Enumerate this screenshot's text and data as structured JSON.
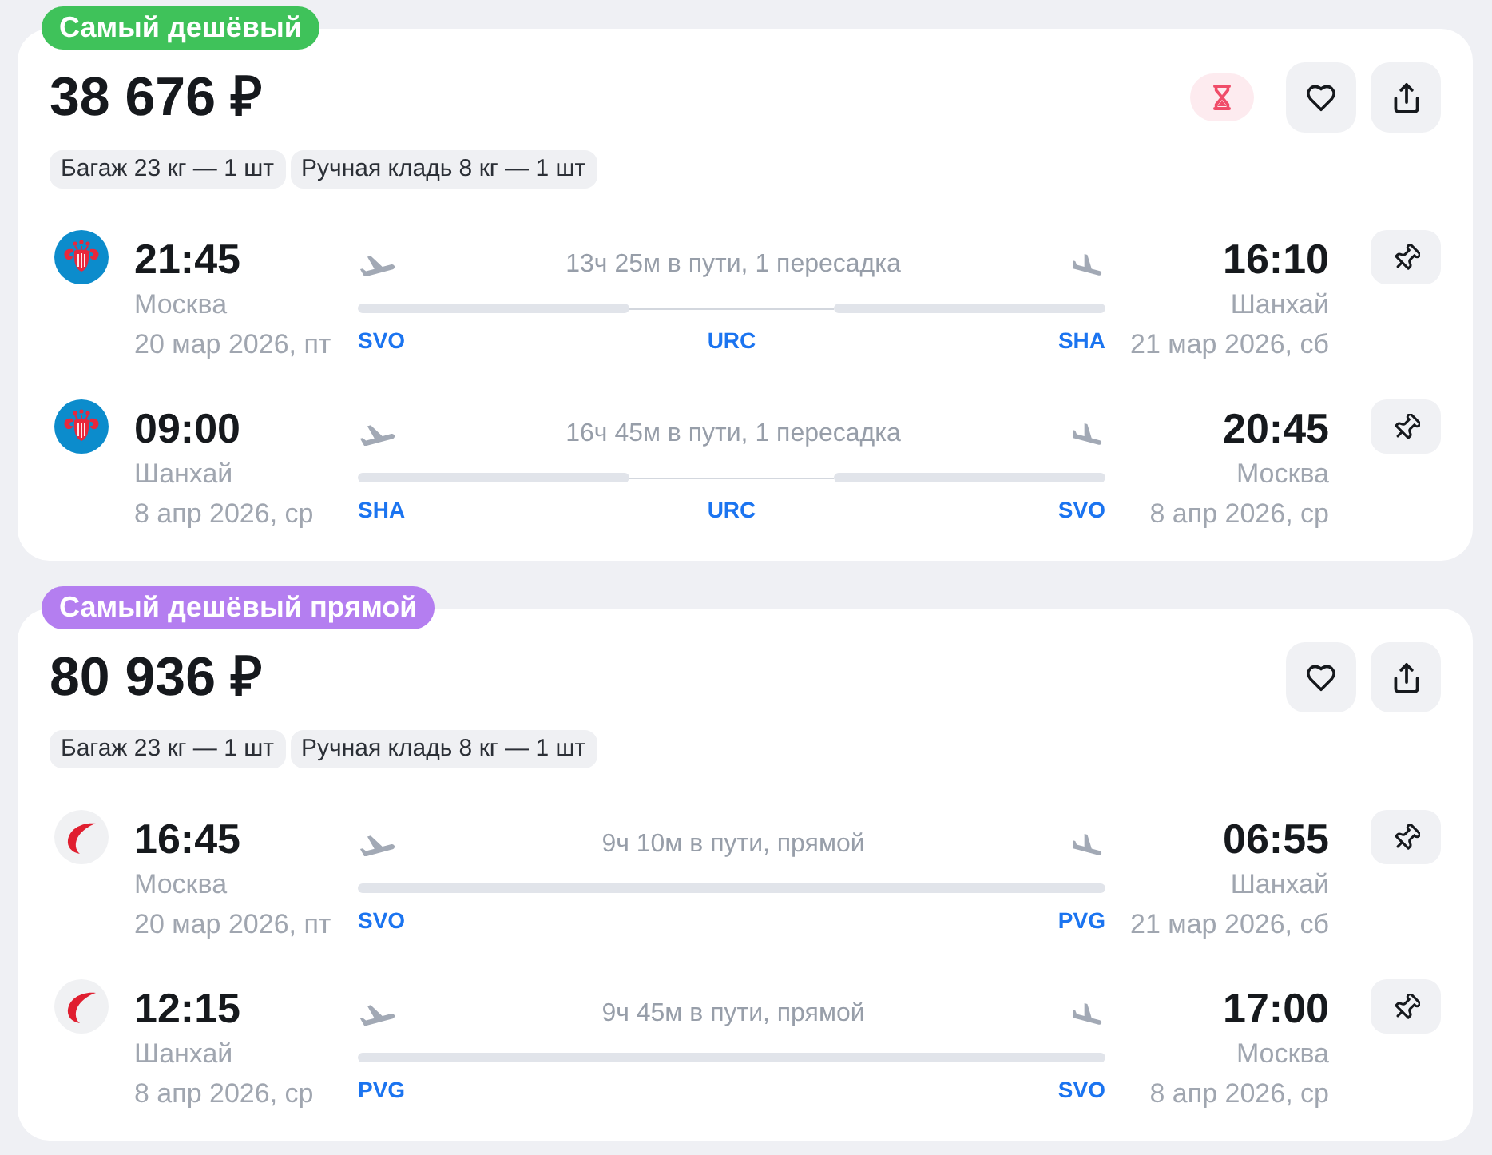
{
  "offers": [
    {
      "badge": {
        "text": "Самый дешёвый",
        "color": "#3fc25a"
      },
      "price": "38 676 ₽",
      "price_timer": true,
      "favorite": false,
      "baggage": [
        "Багаж 23 кг — 1 шт",
        "Ручная кладь 8 кг — 1 шт"
      ],
      "segments": [
        {
          "kind": "flower",
          "departure": {
            "time": "21:45",
            "city": "Москва",
            "date": "20 мар 2026, пт"
          },
          "duration": "13ч 25м в пути, 1 пересадка",
          "stops": [
            "SVO",
            "URC",
            "SHA"
          ],
          "arrival": {
            "time": "16:10",
            "city": "Шанхай",
            "date": "21 мар 2026, сб"
          }
        },
        {
          "kind": "flower",
          "departure": {
            "time": "09:00",
            "city": "Шанхай",
            "date": "8 апр 2026, ср"
          },
          "duration": "16ч 45м в пути, 1 пересадка",
          "stops": [
            "SHA",
            "URC",
            "SVO"
          ],
          "arrival": {
            "time": "20:45",
            "city": "Москва",
            "date": "8 апр 2026, ср"
          }
        }
      ]
    },
    {
      "badge": {
        "text": "Самый дешёвый прямой",
        "color": "#b47ef0"
      },
      "price": "80 936 ₽",
      "price_timer": false,
      "favorite": false,
      "baggage": [
        "Багаж 23 кг — 1 шт",
        "Ручная кладь 8 кг — 1 шт"
      ],
      "segments": [
        {
          "kind": "crescent",
          "departure": {
            "time": "16:45",
            "city": "Москва",
            "date": "20 мар 2026, пт"
          },
          "duration": "9ч 10м в пути, прямой",
          "stops": [
            "SVO",
            "PVG"
          ],
          "arrival": {
            "time": "06:55",
            "city": "Шанхай",
            "date": "21 мар 2026, сб"
          }
        },
        {
          "kind": "crescent",
          "departure": {
            "time": "12:15",
            "city": "Шанхай",
            "date": "8 апр 2026, ср"
          },
          "duration": "9ч 45м в пути, прямой",
          "stops": [
            "PVG",
            "SVO"
          ],
          "arrival": {
            "time": "17:00",
            "city": "Москва",
            "date": "8 апр 2026, ср"
          }
        }
      ]
    }
  ]
}
